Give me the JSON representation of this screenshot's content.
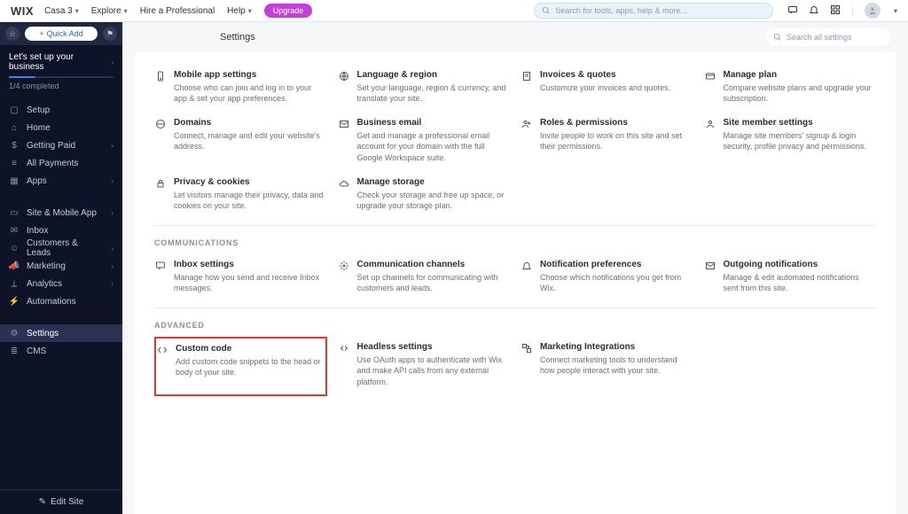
{
  "topbar": {
    "logo": "WIX",
    "site_name": "Casa 3",
    "explore": "Explore",
    "hire": "Hire a Professional",
    "help": "Help",
    "upgrade": "Upgrade",
    "search_placeholder": "Search for tools, apps, help & more..."
  },
  "sidebar": {
    "quick_add": "Quick Add",
    "setup_title": "Let's set up your business",
    "progress": "1/4 completed",
    "items": [
      {
        "icon": "setup",
        "label": "Setup",
        "chev": false
      },
      {
        "icon": "home",
        "label": "Home",
        "chev": false
      },
      {
        "icon": "money",
        "label": "Getting Paid",
        "chev": true
      },
      {
        "icon": "payments",
        "label": "All Payments",
        "chev": false
      },
      {
        "icon": "apps",
        "label": "Apps",
        "chev": true
      }
    ],
    "items2": [
      {
        "icon": "mobile",
        "label": "Site & Mobile App",
        "chev": true
      },
      {
        "icon": "inbox",
        "label": "Inbox",
        "chev": false
      },
      {
        "icon": "customers",
        "label": "Customers & Leads",
        "chev": true
      },
      {
        "icon": "marketing",
        "label": "Marketing",
        "chev": true
      },
      {
        "icon": "analytics",
        "label": "Analytics",
        "chev": true
      },
      {
        "icon": "automations",
        "label": "Automations",
        "chev": false
      }
    ],
    "items3": [
      {
        "icon": "settings",
        "label": "Settings",
        "chev": false,
        "active": true
      },
      {
        "icon": "cms",
        "label": "CMS",
        "chev": false
      }
    ],
    "edit_site": "Edit Site"
  },
  "page": {
    "title": "Settings",
    "search_placeholder": "Search all settings",
    "sections": [
      {
        "title": "",
        "cards": [
          {
            "icon": "phone",
            "title": "Mobile app settings",
            "desc": "Choose who can join and log in to your app & set your app preferences."
          },
          {
            "icon": "globe",
            "title": "Language & region",
            "desc": "Set your language, region & currency, and translate your site."
          },
          {
            "icon": "invoice",
            "title": "Invoices & quotes",
            "desc": "Customize your invoices and quotes."
          },
          {
            "icon": "card",
            "title": "Manage plan",
            "desc": "Compare website plans and upgrade your subscription."
          }
        ]
      },
      {
        "title": "",
        "cards": [
          {
            "icon": "domain",
            "title": "Domains",
            "desc": "Connect, manage and edit your website's address."
          },
          {
            "icon": "mail",
            "title": "Business email",
            "desc": "Get and manage a professional email account for your domain with the full Google Workspace suite."
          },
          {
            "icon": "roles",
            "title": "Roles & permissions",
            "desc": "Invite people to work on this site and set their permissions."
          },
          {
            "icon": "member",
            "title": "Site member settings",
            "desc": "Manage site members' signup & login security, profile privacy and permissions."
          }
        ]
      },
      {
        "title": "",
        "cards": [
          {
            "icon": "lock",
            "title": "Privacy & cookies",
            "desc": "Let visitors manage their privacy, data and cookies on your site."
          },
          {
            "icon": "cloud",
            "title": "Manage storage",
            "desc": "Check your storage and free up space, or upgrade your storage plan."
          }
        ]
      },
      {
        "title": "COMMUNICATIONS",
        "cards": [
          {
            "icon": "chat",
            "title": "Inbox settings",
            "desc": "Manage how you send and receive Inbox messages."
          },
          {
            "icon": "channels",
            "title": "Communication channels",
            "desc": "Set up channels for communicating with customers and leads."
          },
          {
            "icon": "bell",
            "title": "Notification preferences",
            "desc": "Choose which notifications you get from Wix."
          },
          {
            "icon": "outgoing",
            "title": "Outgoing notifications",
            "desc": "Manage & edit automated notifications sent from this site."
          }
        ]
      },
      {
        "title": "ADVANCED",
        "cards": [
          {
            "icon": "code",
            "title": "Custom code",
            "desc": "Add custom code snippets to the head or body of your site.",
            "highlight": true
          },
          {
            "icon": "headless",
            "title": "Headless settings",
            "desc": "Use OAuth apps to authenticate with Wix and make API calls from any external platform."
          },
          {
            "icon": "integration",
            "title": "Marketing Integrations",
            "desc": "Connect marketing tools to understand how people interact with your site."
          }
        ]
      }
    ]
  }
}
